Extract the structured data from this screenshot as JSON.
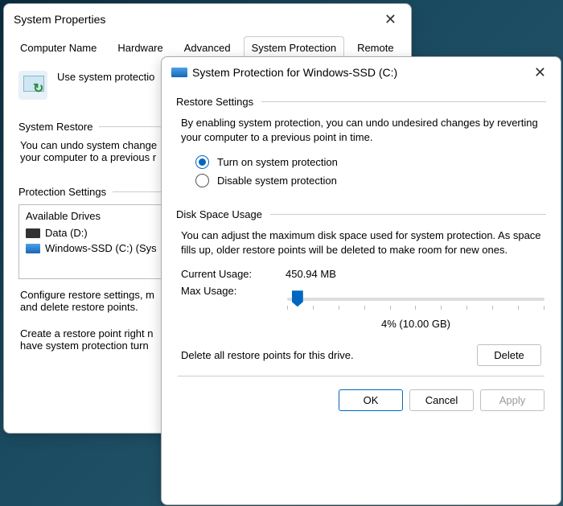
{
  "bg": {
    "title": "System Properties",
    "tabs": [
      "Computer Name",
      "Hardware",
      "Advanced",
      "System Protection",
      "Remote"
    ],
    "active_tab": 3,
    "intro": "Use system protectio",
    "grp_restore": "System Restore",
    "restore_desc1": "You can undo system change",
    "restore_desc2": "your computer to a previous r",
    "grp_protect": "Protection Settings",
    "drives_hdr": "Available Drives",
    "drives": [
      {
        "label": "Data (D:)",
        "blue": false
      },
      {
        "label": "Windows-SSD (C:) (Sys",
        "blue": true
      }
    ],
    "configure1": "Configure restore settings, m",
    "configure2": "and delete restore points.",
    "create1": "Create a restore point right n",
    "create2": "have system protection turn"
  },
  "fg": {
    "title": "System Protection for Windows-SSD (C:)",
    "sec_restore": "Restore Settings",
    "restore_para": "By enabling system protection, you can undo undesired changes by reverting your computer to a previous point in time.",
    "radio_on": "Turn on system protection",
    "radio_off": "Disable system protection",
    "sec_disk": "Disk Space Usage",
    "disk_para": "You can adjust the maximum disk space used for system protection. As space fills up, older restore points will be deleted to make room for new ones.",
    "cur_label": "Current Usage:",
    "cur_value": "450.94 MB",
    "max_label": "Max Usage:",
    "max_value": "4% (10.00 GB)",
    "del_text": "Delete all restore points for this drive.",
    "btn_delete": "Delete",
    "btn_ok": "OK",
    "btn_cancel": "Cancel",
    "btn_apply": "Apply"
  }
}
